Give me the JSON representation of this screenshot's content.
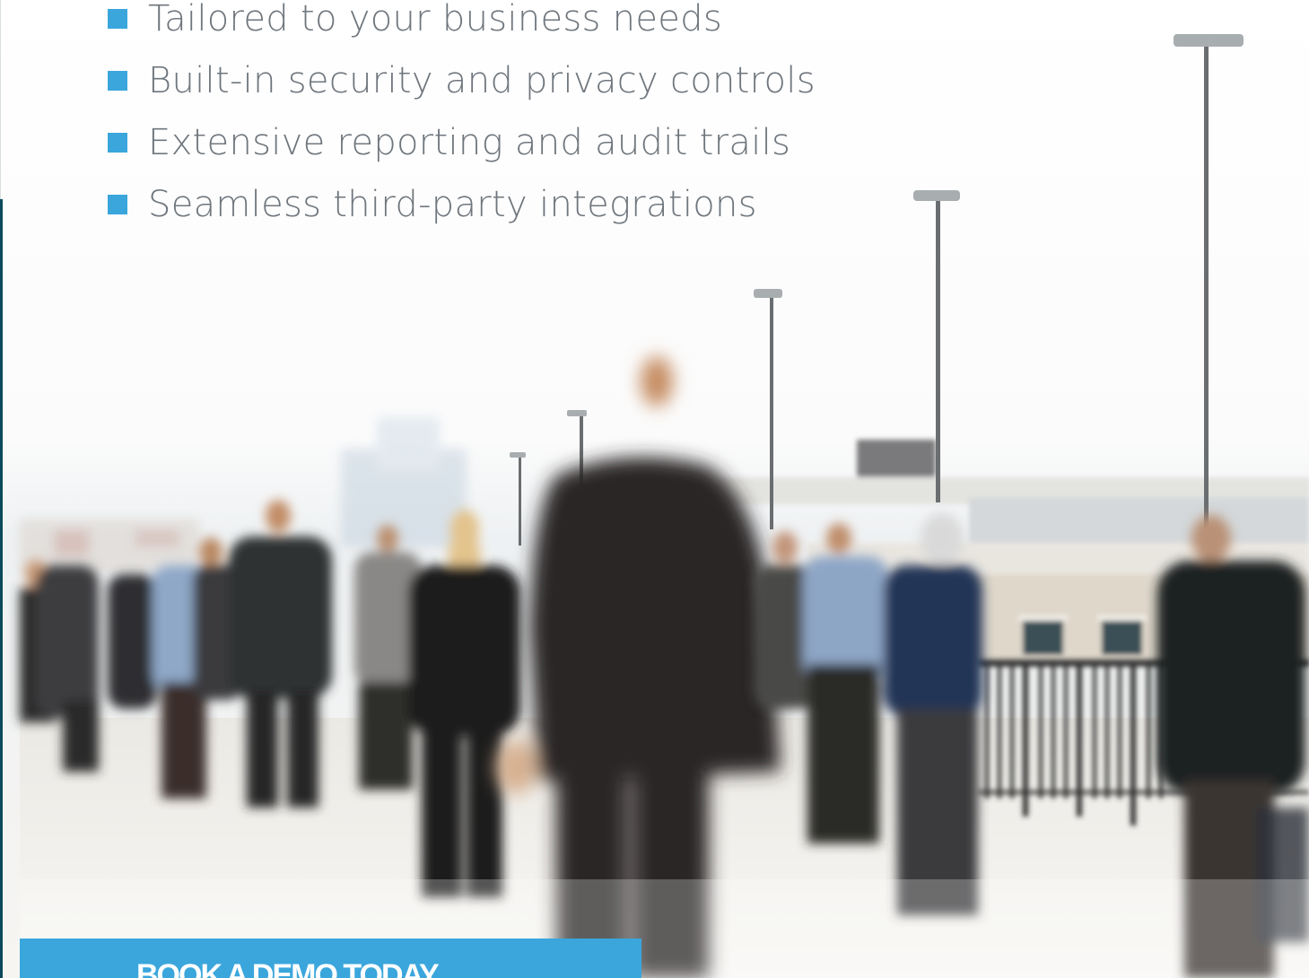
{
  "features": {
    "items": [
      {
        "label": "Tailored to your business needs"
      },
      {
        "label": "Built-in security and privacy controls"
      },
      {
        "label": "Extensive reporting and audit trails"
      },
      {
        "label": "Seamless third-party integrations"
      }
    ],
    "bullet_color": "#3aa6dc",
    "text_color": "#6f767d"
  },
  "cta": {
    "label": "BOOK A DEMO TODAY",
    "background": "#3aa6dc"
  },
  "hero_image": {
    "icon": "commuters-photo"
  },
  "theme": {
    "edge_color": "#0b4a5c"
  }
}
